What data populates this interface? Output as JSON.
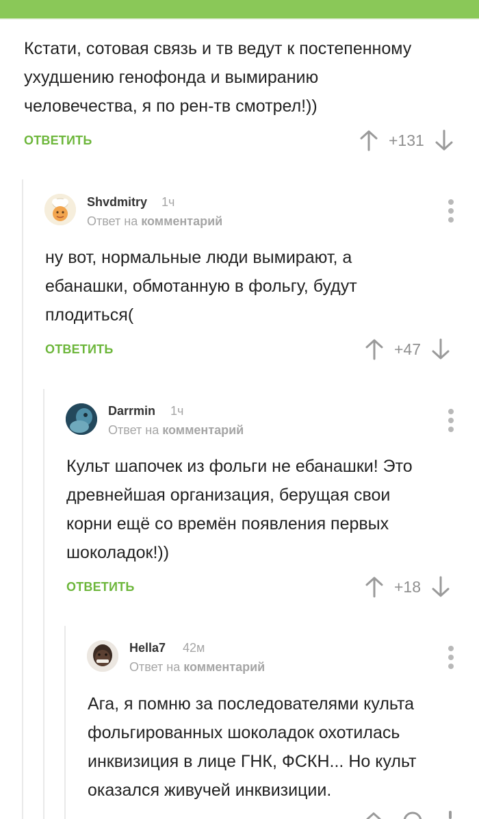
{
  "colors": {
    "accent": "#8ac858",
    "reply": "#6cb63a",
    "muted": "#a5a5a5"
  },
  "top_comment": {
    "text": "Кстати, сотовая связь и тв ведут к постепенному\nухудшению генофонда и вымиранию\nчеловечества, я по рен-тв смотрел!))",
    "reply_label": "ОТВЕТИТЬ",
    "score": "+131"
  },
  "comments": [
    {
      "author": "Shvdmitry",
      "time": "1ч",
      "reply_to_prefix": "Ответ на",
      "reply_to_target": "комментарий",
      "text": "ну вот, нормальные люди вымирают, а\nебанашки, обмотанную в фольгу, будут\nплодиться(",
      "reply_label": "ОТВЕТИТЬ",
      "score": "+47",
      "avatar_icon": "chef-cartoon-avatar"
    },
    {
      "author": "Darrmin",
      "time": "1ч",
      "reply_to_prefix": "Ответ на",
      "reply_to_target": "комментарий",
      "text": "Культ шапочек из фольги не ебанашки! Это\nдревнейшая организация, берущая свои\nкорни ещё со времён появления первых\nшоколадок!))",
      "reply_label": "ОТВЕТИТЬ",
      "score": "+18",
      "avatar_icon": "dark-photo-avatar"
    },
    {
      "author": "Hella7",
      "time": "42м",
      "reply_to_prefix": "Ответ на",
      "reply_to_target": "комментарий",
      "text": "Ага, я помню за последователями культа\nфольгированных шоколадок охотилась\nинквизиция в лице ГНК, ФСКН... Но культ\nоказался живучей инквизиции.",
      "avatar_icon": "person-photo-avatar"
    }
  ]
}
